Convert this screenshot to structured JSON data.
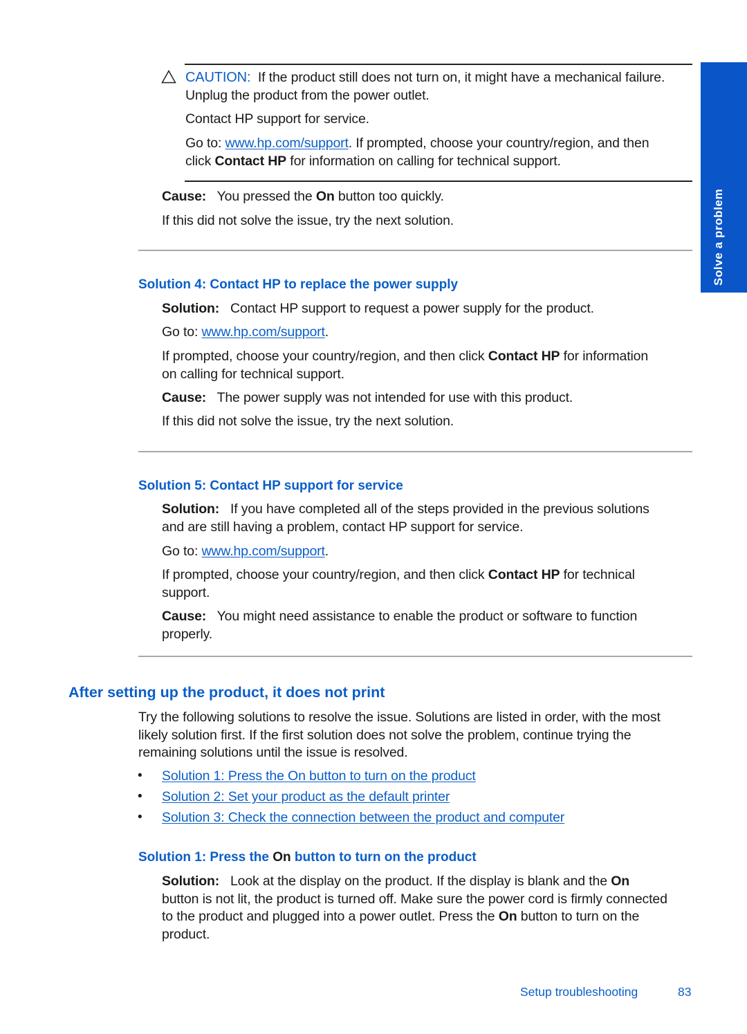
{
  "side_tab": {
    "label": "Solve a problem",
    "color": "#0a56c8"
  },
  "caution": {
    "icon": "caution-triangle-icon",
    "label": "CAUTION:",
    "text": "If the product still does not turn on, it might have a mechanical failure. Unplug the product from the power outlet.",
    "contact_line": "Contact HP support for service.",
    "goto_prefix": "Go to: ",
    "goto_link": "www.hp.com/support",
    "goto_suffix_1": ". If prompted, choose your country/region, and then",
    "goto_suffix_2a": "click ",
    "goto_bold": "Contact HP",
    "goto_suffix_2b": " for information on calling for technical support."
  },
  "solution3_tail": {
    "cause_label": "Cause:",
    "cause_pre": "You pressed the ",
    "cause_bold": "On",
    "cause_post": " button too quickly.",
    "next": "If this did not solve the issue, try the next solution."
  },
  "solution4": {
    "title": "Solution 4: Contact HP to replace the power supply",
    "solution_label": "Solution:",
    "solution_text": "Contact HP support to request a power supply for the product.",
    "goto_prefix": "Go to: ",
    "goto_link": "www.hp.com/support",
    "goto_suffix": ".",
    "prompt_pre": "If prompted, choose your country/region, and then click ",
    "prompt_bold": "Contact HP",
    "prompt_post_1": " for information",
    "prompt_post_2": "on calling for technical support.",
    "cause_label": "Cause:",
    "cause_text": "The power supply was not intended for use with this product.",
    "next": "If this did not solve the issue, try the next solution."
  },
  "solution5": {
    "title": "Solution 5: Contact HP support for service",
    "solution_label": "Solution:",
    "solution_text_1": "If you have completed all of the steps provided in the previous solutions",
    "solution_text_2": "and are still having a problem, contact HP support for service.",
    "goto_prefix": "Go to: ",
    "goto_link": "www.hp.com/support",
    "goto_suffix": ".",
    "prompt_pre": "If prompted, choose your country/region, and then click ",
    "prompt_bold": "Contact HP",
    "prompt_post_1": " for technical",
    "prompt_post_2": "support.",
    "cause_label": "Cause:",
    "cause_text_1": "You might need assistance to enable the product or software to function",
    "cause_text_2": "properly."
  },
  "section": {
    "title": "After setting up the product, it does not print",
    "intro_1": "Try the following solutions to resolve the issue. Solutions are listed in order, with the most",
    "intro_2": "likely solution first. If the first solution does not solve the problem, continue trying the",
    "intro_3": "remaining solutions until the issue is resolved.",
    "links": [
      "Solution 1: Press the On button to turn on the product",
      "Solution 2: Set your product as the default printer",
      "Solution 3: Check the connection between the product and computer"
    ]
  },
  "solution1": {
    "title_pre": "Solution 1: Press the ",
    "title_bold": "On",
    "title_post": " button to turn on the product",
    "solution_label": "Solution:",
    "line1_pre": "Look at the display on the product. If the display is blank and the ",
    "line1_bold": "On",
    "line2": "button is not lit, the product is turned off. Make sure the power cord is firmly connected",
    "line3_pre": "to the product and plugged into a power outlet. Press the ",
    "line3_bold": "On",
    "line3_post": " button to turn on the",
    "line4": "product."
  },
  "footer": {
    "section": "Setup troubleshooting",
    "page": "83"
  }
}
